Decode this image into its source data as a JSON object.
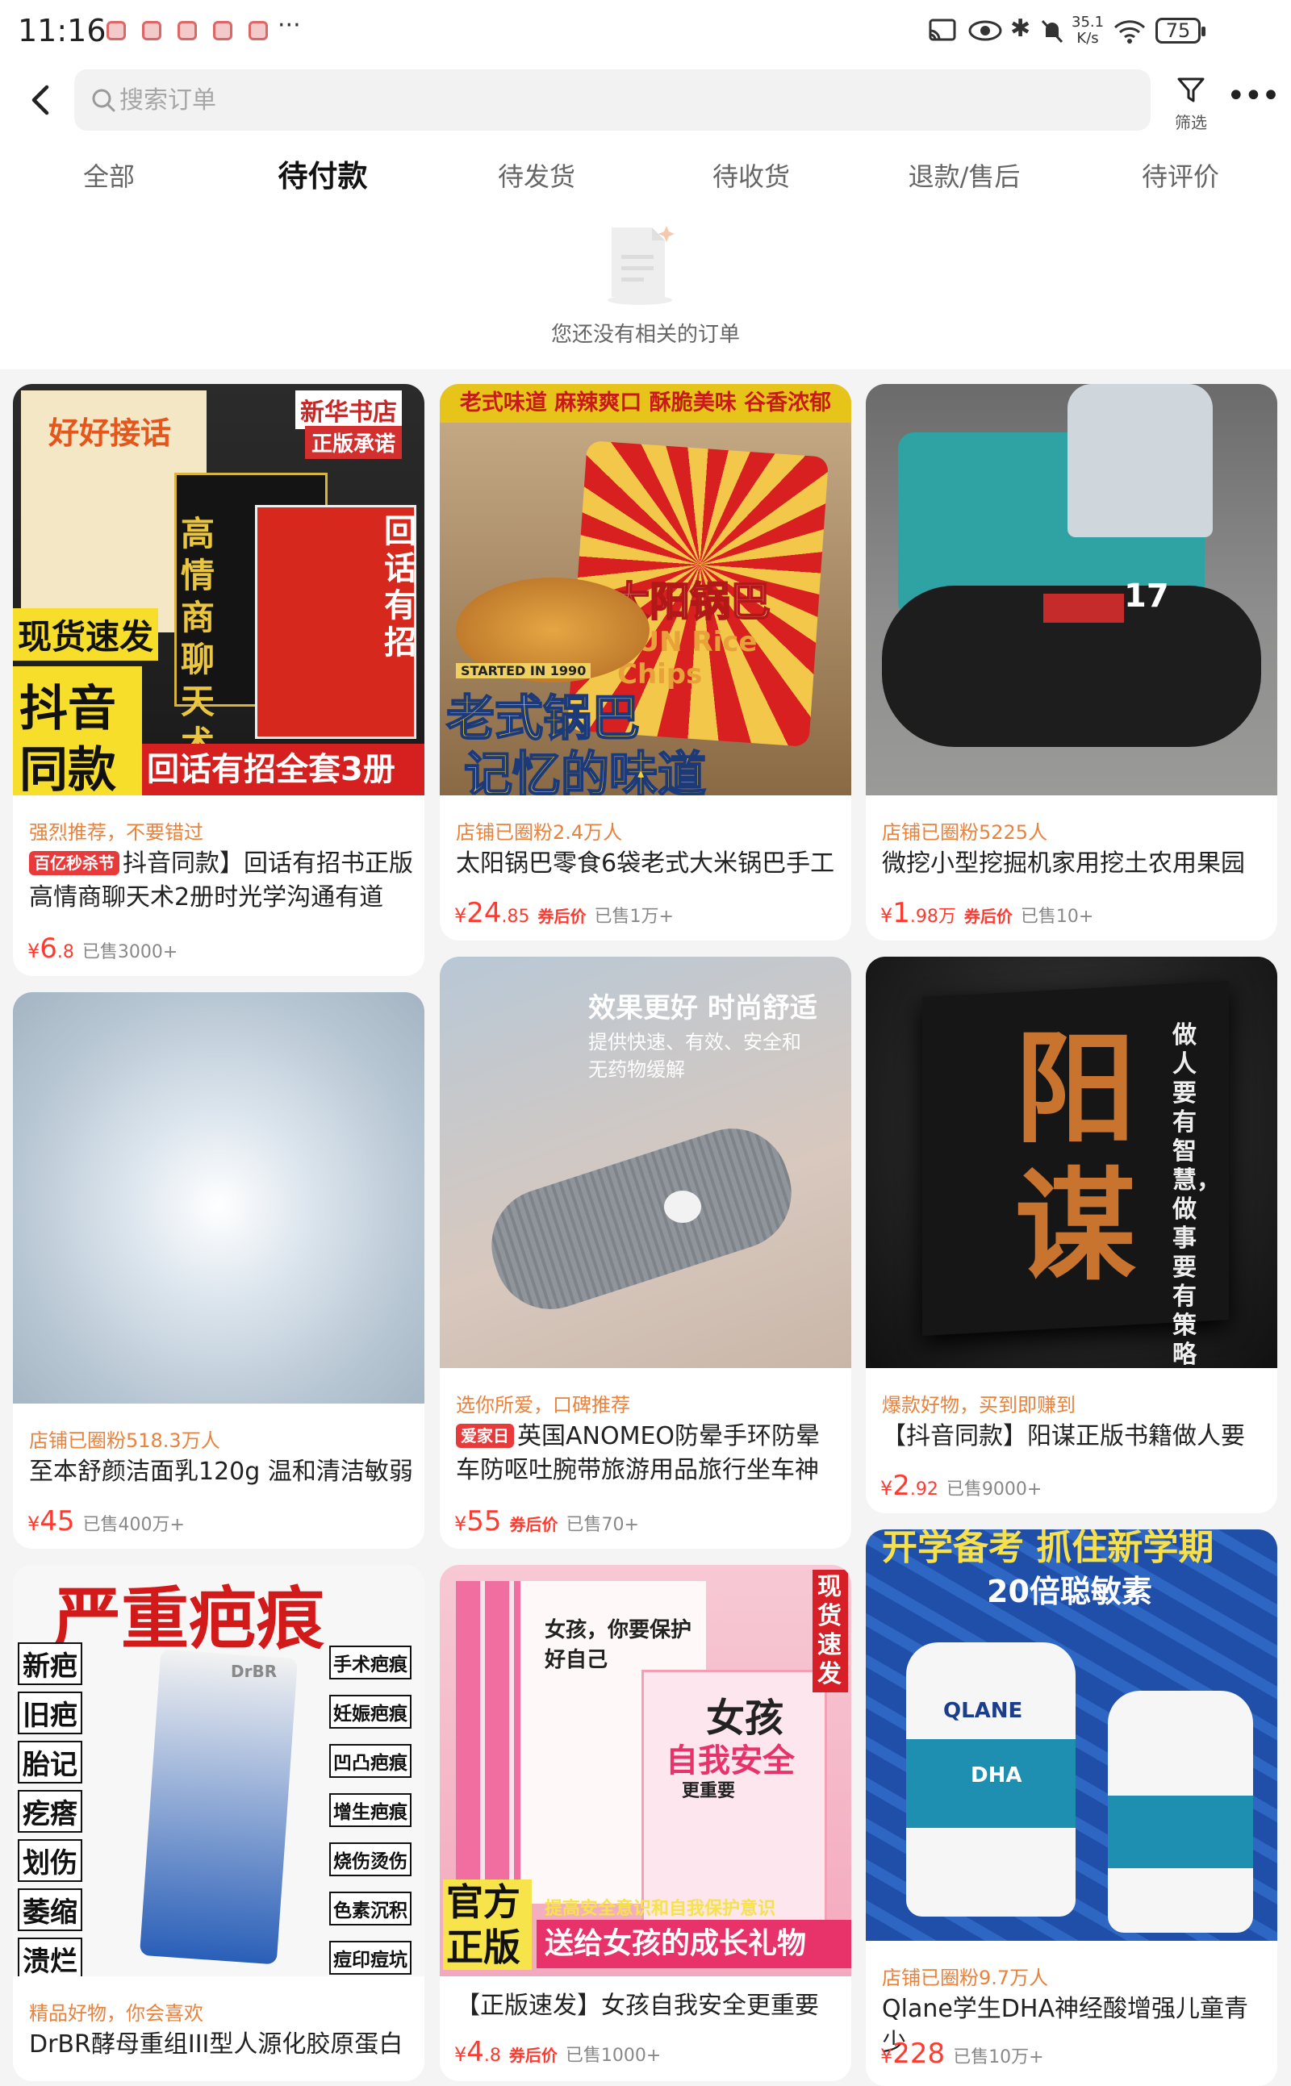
{
  "status_bar": {
    "time": "11:16",
    "more": "···",
    "speed_value": "35.1",
    "speed_unit": "K/s",
    "battery": "75"
  },
  "search": {
    "placeholder": "搜索订单"
  },
  "filter_label": "筛选",
  "tabs": [
    "全部",
    "待付款",
    "待发货",
    "待收货",
    "退款/售后",
    "待评价"
  ],
  "active_tab": "待付款",
  "empty_state": "您还没有相关的订单",
  "products": [
    {
      "tag": "强烈推荐，不要错过",
      "badge": "百亿秒杀节",
      "title": "抖音同款】回话有招书正版高情商聊天术2册时光学沟通有道",
      "price_int": "6",
      "price_dec": ".8",
      "after_price": "",
      "sold": "已售3000+",
      "image_text": {
        "a": "好好接话",
        "b": "新华书店",
        "c": "正版承诺",
        "d": "高情商聊天术",
        "e": "回话有招",
        "f": "现货速发",
        "g": "抖音",
        "h": "同款",
        "i": "回话有招全套3册"
      }
    },
    {
      "tag": "店铺已圈粉2.4万人",
      "badge": "",
      "title": "太阳锅巴零食6袋老式大米锅巴手工",
      "price_int": "24",
      "price_dec": ".85",
      "after_price": "券后价",
      "sold": "已售1万+",
      "image_text": {
        "a": "老式味道 麻辣爽口 酥脆美味 谷香浓郁",
        "b": "太阳锅巴",
        "c": "SUN Rice Chips",
        "d": "STARTED IN 1990",
        "e": "老式锅巴",
        "f": "记忆的味道"
      }
    },
    {
      "tag": "店铺已圈粉5225人",
      "badge": "",
      "title": "微挖小型挖掘机家用挖土农用果园",
      "price_int": "1",
      "price_dec": ".98万",
      "after_price": "券后价",
      "sold": "已售10+",
      "image_text": {
        "a": "17"
      }
    },
    {
      "tag": "店铺已圈粉518.3万人",
      "badge": "",
      "title": "至本舒颜洁面乳120g 温和清洁敏弱",
      "price_int": "45",
      "price_dec": "",
      "after_price": "",
      "sold": "已售400万+",
      "image_text": {}
    },
    {
      "tag": "选你所爱，口碑推荐",
      "badge": "爱家日",
      "title": "英国ANOMEO防晕手环防晕车防呕吐腕带旅游用品旅行坐车神",
      "price_int": "55",
      "price_dec": "",
      "after_price": "券后价",
      "sold": "已售70+",
      "image_text": {
        "a": "效果更好 时尚舒适",
        "b": "提供快速、有效、安全和",
        "c": "无药物缓解"
      }
    },
    {
      "tag": "爆款好物，买到即赚到",
      "badge": "",
      "title": "【抖音同款】阳谋正版书籍做人要",
      "price_int": "2",
      "price_dec": ".92",
      "after_price": "",
      "sold": "已售9000+",
      "image_text": {
        "a": "阳谋",
        "b": "做人要有智慧，做事要有策略"
      }
    },
    {
      "tag": "精品好物，你会喜欢",
      "badge": "",
      "title": "DrBR酵母重组III型人源化胶原蛋白",
      "price_int": "",
      "price_dec": "",
      "after_price": "",
      "sold": "",
      "image_text": {
        "a": "严重疤痕",
        "left": [
          "新疤",
          "旧疤",
          "胎记",
          "疙瘩",
          "划伤",
          "萎缩",
          "溃烂"
        ],
        "right": [
          "手术疤痕",
          "妊娠疤痕",
          "凹凸疤痕",
          "增生疤痕",
          "烧伤烫伤",
          "色素沉积",
          "痘印痘坑"
        ],
        "b": "DrBR"
      }
    },
    {
      "tag": "",
      "badge": "",
      "title": "【正版速发】女孩自我安全更重要",
      "price_int": "4",
      "price_dec": ".8",
      "after_price": "券后价",
      "sold": "已售1000+",
      "image_text": {
        "a": "现货速发",
        "b": "女孩，你要保护好自己",
        "c": "女孩",
        "d": "自我安全",
        "e": "更重要",
        "f": "官方正版",
        "g": "提高安全意识和自我保护意识",
        "h": "送给女孩的成长礼物"
      }
    },
    {
      "tag": "店铺已圈粉9.7万人",
      "badge": "",
      "title": "Qlane学生DHA神经酸增强儿童青少",
      "price_int": "228",
      "price_dec": "",
      "after_price": "",
      "sold": "已售10万+",
      "image_text": {
        "a": "开学备考 抓住新学期",
        "b": "20倍聪敏素",
        "c": "QLANE",
        "d": "DHA"
      }
    }
  ],
  "colors": {
    "price": "#ff3b30",
    "tag": "#e8823c",
    "badge": "#e83a3a"
  }
}
